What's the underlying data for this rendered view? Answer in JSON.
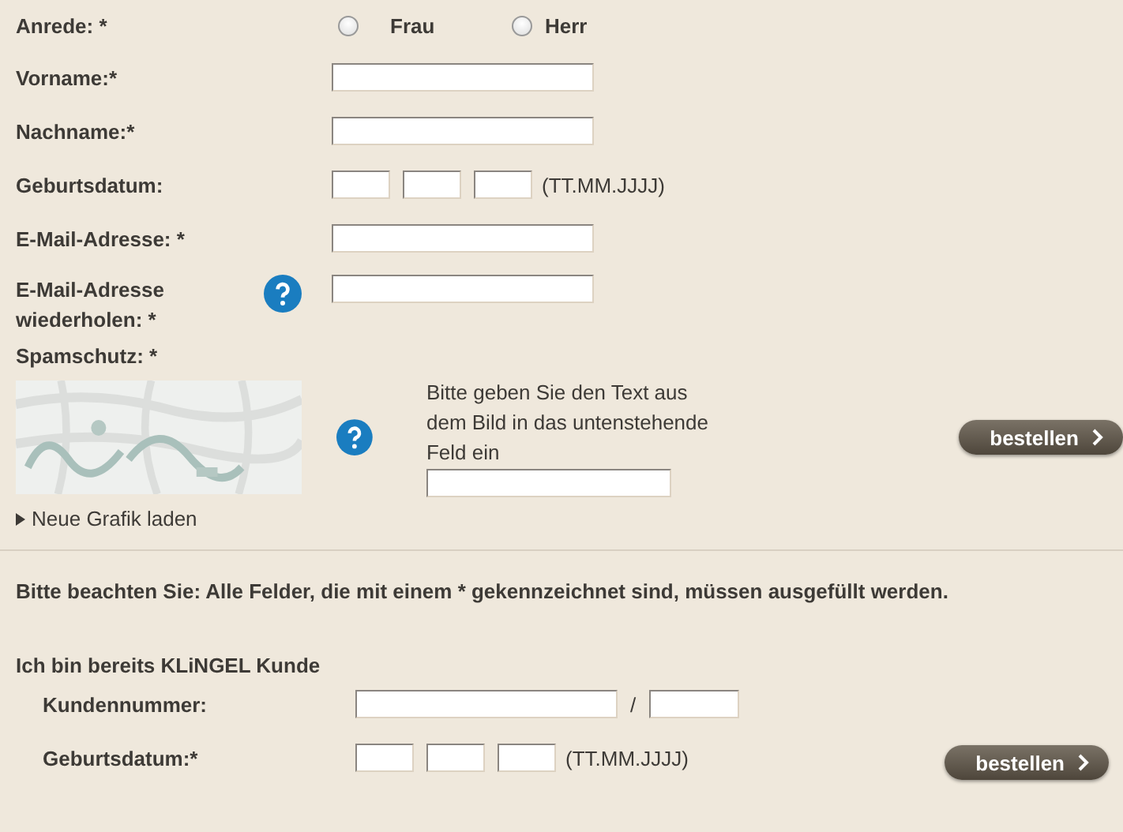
{
  "salutation": {
    "label": "Anrede: *",
    "options": [
      {
        "label": "Frau",
        "selected": false
      },
      {
        "label": "Herr",
        "selected": false
      }
    ]
  },
  "fields": [
    {
      "kind": "text",
      "label": "Vorname:*"
    },
    {
      "kind": "text",
      "label": "Nachname:*"
    },
    {
      "kind": "date",
      "label": "Geburtsdatum:",
      "hint": "(TT.MM.JJJJ)"
    },
    {
      "kind": "text",
      "label": "E-Mail-Adresse: *"
    },
    {
      "kind": "text",
      "label": "E-Mail-Adresse wiederholen: *",
      "help": true
    }
  ],
  "spam": {
    "label": "Spamschutz: *",
    "instructions": "Bitte geben Sie den Text aus dem Bild in das untenstehende Feld ein",
    "reload_link": "Neue Grafik laden",
    "button": "bestellen"
  },
  "note": "Bitte beachten Sie: Alle Felder, die mit einem * gekennzeichnet sind, müssen ausgefüllt werden.",
  "customer": {
    "heading": "Ich bin bereits KLiNGEL Kunde",
    "number_label": "Kundennummer:",
    "separator": "/",
    "birthdate_label": "Geburtsdatum:*",
    "date_hint": "(TT.MM.JJJJ)",
    "button": "bestellen"
  }
}
